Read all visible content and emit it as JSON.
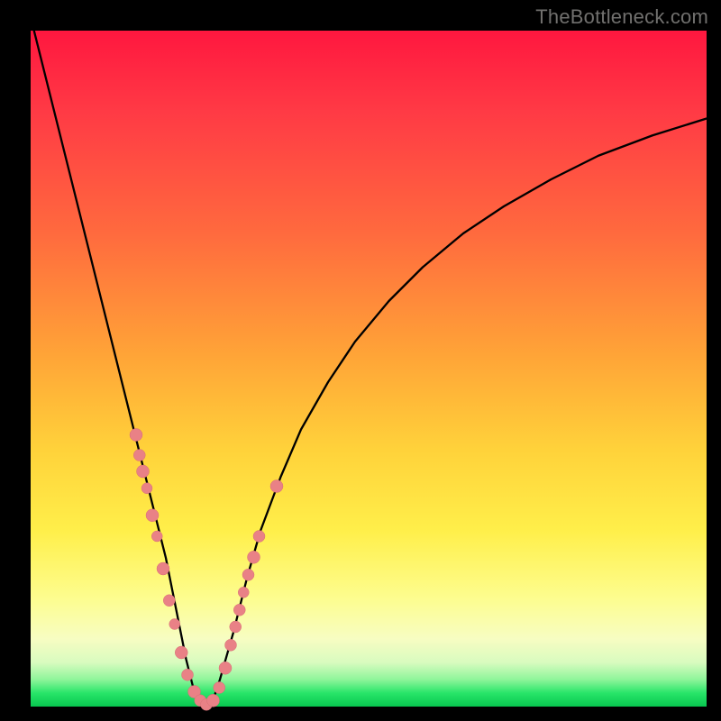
{
  "watermark": "TheBottleneck.com",
  "colors": {
    "background": "#000000",
    "curve": "#000000",
    "marker_fill": "#e98186",
    "marker_stroke": "#d76f75",
    "gradient_top": "#ff173f",
    "gradient_bottom": "#08c64f"
  },
  "chart_data": {
    "type": "line",
    "title": "",
    "xlabel": "",
    "ylabel": "",
    "xlim": [
      0,
      100
    ],
    "ylim": [
      0,
      100
    ],
    "curve": {
      "x": [
        0,
        2,
        4,
        6,
        8,
        10,
        12,
        14,
        16,
        17,
        18,
        19,
        20,
        21,
        22,
        23,
        24,
        25,
        26,
        27,
        28,
        30,
        32,
        34,
        37,
        40,
        44,
        48,
        53,
        58,
        64,
        70,
        77,
        84,
        92,
        100
      ],
      "y": [
        102,
        94,
        86,
        78,
        70,
        62,
        54,
        46,
        38,
        34,
        30,
        26,
        22,
        17,
        12,
        7,
        3,
        1,
        0.2,
        1,
        4,
        11,
        19,
        26,
        34,
        41,
        48,
        54,
        60,
        65,
        70,
        74,
        78,
        81.5,
        84.5,
        87
      ]
    },
    "markers": [
      {
        "x": 15.6,
        "y": 40.2,
        "r": 7
      },
      {
        "x": 16.1,
        "y": 37.2,
        "r": 6.5
      },
      {
        "x": 16.6,
        "y": 34.8,
        "r": 7
      },
      {
        "x": 17.2,
        "y": 32.3,
        "r": 6
      },
      {
        "x": 18.0,
        "y": 28.3,
        "r": 7
      },
      {
        "x": 18.7,
        "y": 25.2,
        "r": 6
      },
      {
        "x": 19.6,
        "y": 20.4,
        "r": 7
      },
      {
        "x": 20.5,
        "y": 15.7,
        "r": 6.5
      },
      {
        "x": 21.3,
        "y": 12.2,
        "r": 6
      },
      {
        "x": 22.3,
        "y": 8.0,
        "r": 7
      },
      {
        "x": 23.2,
        "y": 4.7,
        "r": 6.5
      },
      {
        "x": 24.2,
        "y": 2.2,
        "r": 7
      },
      {
        "x": 25.1,
        "y": 0.9,
        "r": 6.5
      },
      {
        "x": 26.0,
        "y": 0.3,
        "r": 6.5
      },
      {
        "x": 27.0,
        "y": 0.9,
        "r": 7
      },
      {
        "x": 27.9,
        "y": 2.8,
        "r": 6.5
      },
      {
        "x": 28.8,
        "y": 5.7,
        "r": 7
      },
      {
        "x": 29.6,
        "y": 9.1,
        "r": 6.5
      },
      {
        "x": 30.3,
        "y": 11.8,
        "r": 6.5
      },
      {
        "x": 30.9,
        "y": 14.3,
        "r": 6.5
      },
      {
        "x": 31.5,
        "y": 16.9,
        "r": 6
      },
      {
        "x": 32.2,
        "y": 19.5,
        "r": 6.5
      },
      {
        "x": 33.0,
        "y": 22.1,
        "r": 7
      },
      {
        "x": 33.8,
        "y": 25.2,
        "r": 6.5
      },
      {
        "x": 36.4,
        "y": 32.6,
        "r": 7
      }
    ]
  }
}
